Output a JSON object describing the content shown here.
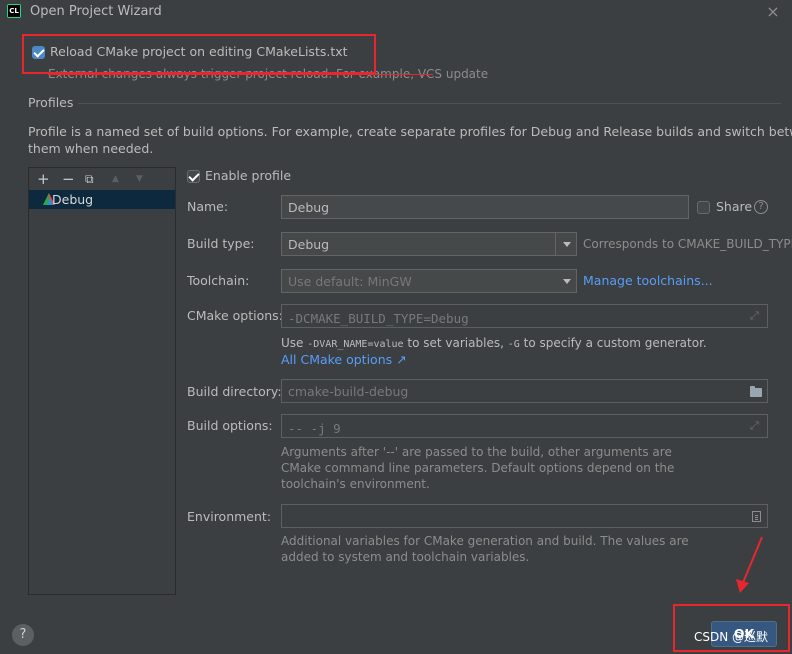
{
  "window": {
    "title": "Open Project Wizard",
    "close_glyph": "×"
  },
  "reload": {
    "checked": true,
    "label": "Reload CMake project on editing CMakeLists.txt",
    "hint": "External changes always trigger project reload. For example, VCS update"
  },
  "profiles": {
    "section_title": "Profiles",
    "description_line1": "Profile is a named set of build options. For example, create separate profiles for Debug and Release builds and switch between",
    "description_line2": "them when needed.",
    "toolbar": {
      "add": "+",
      "remove": "−",
      "copy": "⧉",
      "up": "▲",
      "down": "▼"
    },
    "items": [
      {
        "label": "Debug",
        "icon": "cmake-profile-icon",
        "selected": true
      }
    ]
  },
  "form": {
    "enable_profile_label": "Enable profile",
    "name_label": "Name:",
    "name_value": "Debug",
    "share_label": "Share",
    "help_glyph": "?",
    "build_type_label": "Build type:",
    "build_type_value": "Debug",
    "build_type_hint": "Corresponds to CMAKE_BUILD_TYPE",
    "toolchain_label": "Toolchain:",
    "toolchain_value": "Use default: MinGW",
    "manage_toolchains": "Manage toolchains...",
    "cmake_options_label": "CMake options:",
    "cmake_options_value": "-DCMAKE_BUILD_TYPE=Debug",
    "cmake_hint_use": "Use",
    "cmake_hint_var": "-DVAR_NAME=value",
    "cmake_hint_mid": "to set variables,",
    "cmake_hint_g": "-G",
    "cmake_hint_end": "to specify a custom generator.",
    "all_cmake_options": "All CMake options ↗",
    "build_dir_label": "Build directory:",
    "build_dir_value": "cmake-build-debug",
    "build_options_label": "Build options:",
    "build_options_value": "-- -j 9",
    "build_options_hint1": "Arguments after '--' are passed to the build, other arguments are",
    "build_options_hint2": "CMake command line parameters. Default options depend on the",
    "build_options_hint3": "toolchain's environment.",
    "environment_label": "Environment:",
    "environment_value": "",
    "environment_hint1": "Additional variables for CMake generation and build. The values are",
    "environment_hint2": "added to system and toolchain variables."
  },
  "footer": {
    "help_glyph": "?",
    "ok_label": "OK",
    "watermark": "CSDN @巡默"
  },
  "colors": {
    "background": "#3c3f41",
    "accent": "#4a88c7",
    "link": "#589df6",
    "annotation": "#e8262e"
  }
}
